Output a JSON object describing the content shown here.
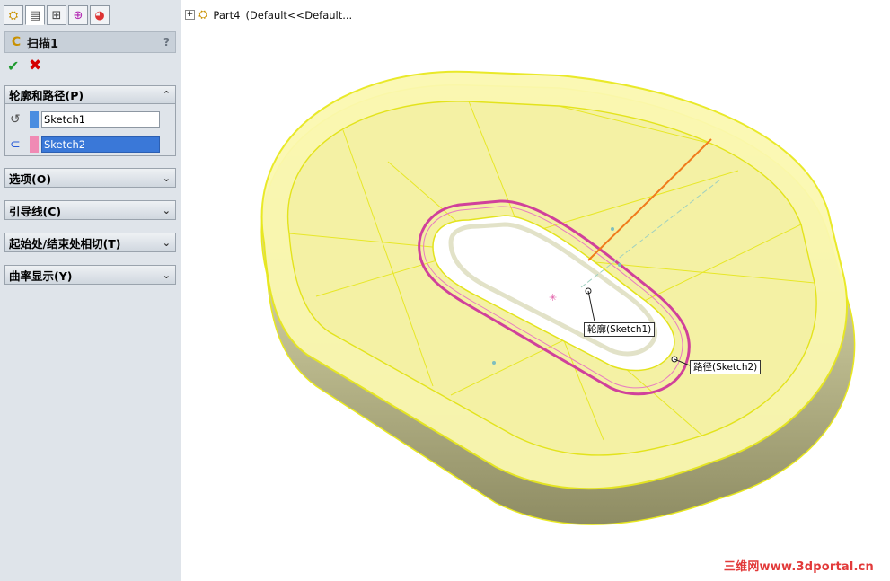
{
  "pm": {
    "tabs": [
      "feature-manager-icon",
      "property-manager-icon",
      "configuration-manager-icon",
      "dimxpert-icon",
      "display-manager-icon"
    ],
    "title": "扫描1",
    "help": "?",
    "ok": "✔",
    "cancel": "✖",
    "profile_path": {
      "header": "轮廓和路径(P)",
      "profile_value": "Sketch1",
      "path_value": "Sketch2",
      "profile_color": "#4a8de0",
      "path_color": "#f08ab4"
    },
    "sections": [
      {
        "label": "选项(O)"
      },
      {
        "label": "引导线(C)"
      },
      {
        "label": "起始处/结束处相切(T)"
      },
      {
        "label": "曲率显示(Y)"
      }
    ]
  },
  "tree": {
    "part": "Part4",
    "config": "(Default<<Default..."
  },
  "callouts": {
    "profile": "轮廓(Sketch1)",
    "path": "路径(Sketch2)"
  },
  "watermark": "三维网www.3dportal.cn",
  "colors": {
    "model_fill": "#fbf8b0",
    "model_edge": "#e8e81e",
    "path": "#d0419b",
    "profile_line": "#f07b1c"
  }
}
